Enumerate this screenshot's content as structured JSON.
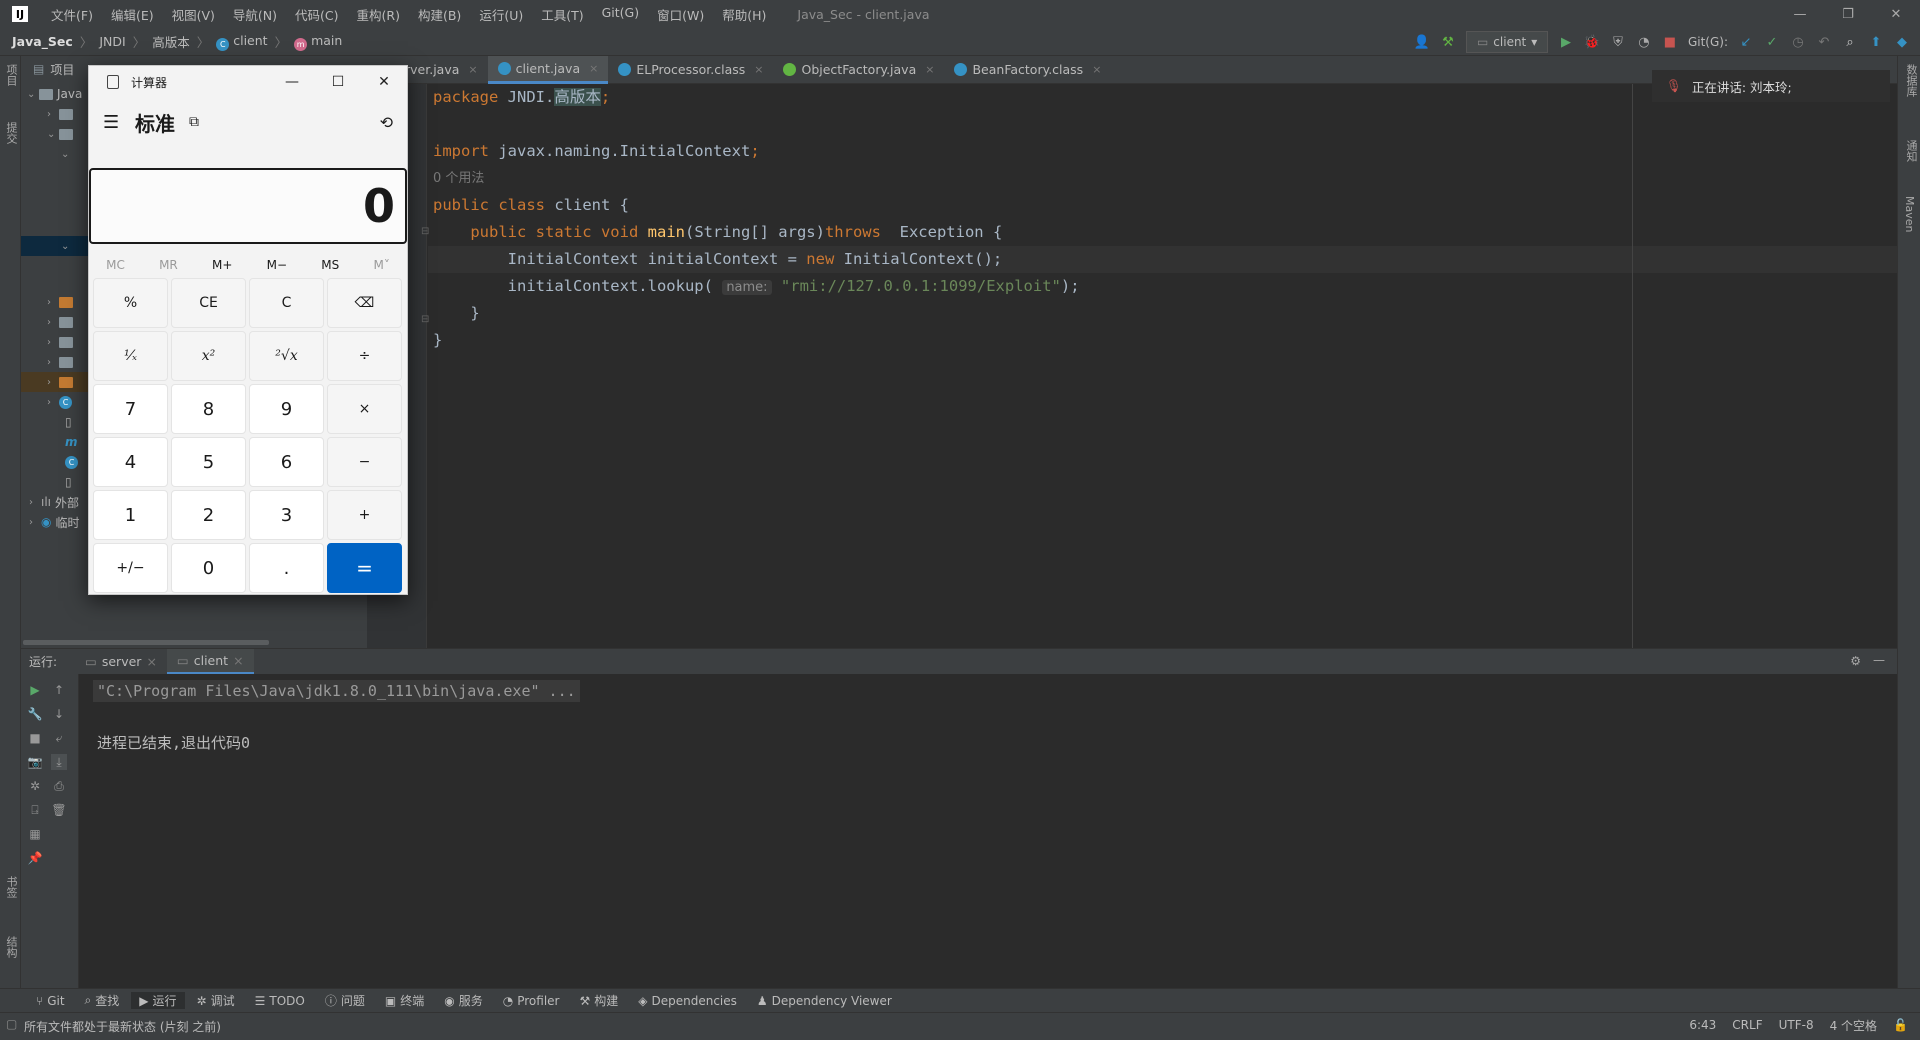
{
  "titlebar": {
    "logo": "IJ",
    "menu": [
      "文件(F)",
      "编辑(E)",
      "视图(V)",
      "导航(N)",
      "代码(C)",
      "重构(R)",
      "构建(B)",
      "运行(U)",
      "工具(T)",
      "Git(G)",
      "窗口(W)",
      "帮助(H)"
    ],
    "window_title": "Java_Sec - client.java"
  },
  "navbar": {
    "project": "Java_Sec",
    "crumbs": [
      "JNDI",
      "高版本",
      "client",
      "main"
    ],
    "run_config": "client",
    "git_label": "Git(G):"
  },
  "left_strip": {
    "project_label": "项目",
    "commit_label": "提交",
    "bookmarks_label": "书签",
    "structure_label": "结构"
  },
  "project_panel": {
    "header": "项目",
    "root": "Java",
    "external_libs": "外部",
    "scratch": "临时"
  },
  "tabs": [
    {
      "label": "rver.java",
      "active": false
    },
    {
      "label": "client.java",
      "active": true
    },
    {
      "label": "ELProcessor.class",
      "active": false
    },
    {
      "label": "ObjectFactory.java",
      "active": false
    },
    {
      "label": "BeanFactory.class",
      "active": false
    }
  ],
  "editor": {
    "package_kw": "package",
    "package_name": "JNDI.",
    "package_hl": "高版本",
    "import_kw": "import",
    "import_name": "javax.naming.InitialContext",
    "usage_hint": "0 个用法",
    "class_decl_kw": "public class",
    "class_name": "client",
    "main_mods": "public static void",
    "main_name": "main",
    "main_params": "(String[] args)",
    "throws_kw": "throws",
    "exception": "Exception {",
    "line_ctx_left": "InitialContext initialContext = ",
    "new_kw": "new",
    "line_ctx_right": " InitialContext();",
    "lookup_call": "initialContext.lookup(",
    "param_hint": "name:",
    "lookup_str": "\"rmi://127.0.0.1:1099/Exploit\"",
    "lookup_end": ");"
  },
  "speaking": {
    "text": "正在讲话: 刘本玲;"
  },
  "right_strip": {
    "db_label": "数据库",
    "notify_label": "通知",
    "maven_label": "Maven"
  },
  "run_panel": {
    "label": "运行:",
    "tabs": [
      {
        "label": "server",
        "active": false
      },
      {
        "label": "client",
        "active": true
      }
    ],
    "console_cmd": "\"C:\\Program Files\\Java\\jdk1.8.0_111\\bin\\java.exe\" ...",
    "console_exit": "进程已结束,退出代码0"
  },
  "bottom_tools": [
    "Git",
    "查找",
    "运行",
    "调试",
    "TODO",
    "问题",
    "终端",
    "服务",
    "Profiler",
    "构建",
    "Dependencies",
    "Dependency Viewer"
  ],
  "statusbar": {
    "message": "所有文件都处于最新状态 (片刻 之前)",
    "position": "6:43",
    "line_sep": "CRLF",
    "encoding": "UTF-8",
    "indent": "4 个空格"
  },
  "calculator": {
    "title": "计算器",
    "mode": "标准",
    "display": "0",
    "memory": [
      "MC",
      "MR",
      "M+",
      "M−",
      "MS",
      "M˅"
    ],
    "keys": [
      "%",
      "CE",
      "C",
      "⌫",
      "¹⁄ₓ",
      "x²",
      "²√x",
      "÷",
      "7",
      "8",
      "9",
      "×",
      "4",
      "5",
      "6",
      "−",
      "1",
      "2",
      "3",
      "+",
      "+/−",
      "0",
      ".",
      "="
    ]
  },
  "colors": {
    "accent": "#4a88c7",
    "calc_equals": "#0063c4",
    "keyword": "#cc7832",
    "string": "#6a8759"
  }
}
